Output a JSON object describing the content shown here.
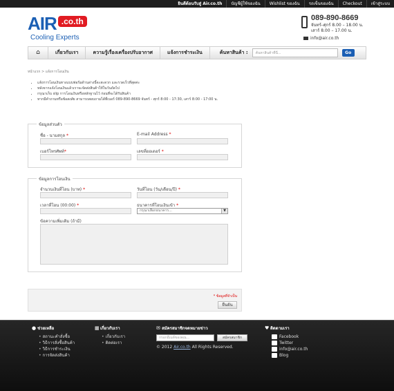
{
  "topbar": {
    "links": [
      "ยินดีต้อนรับสู่ Air.co.th",
      "บัญชีผู้ใช้ของฉัน",
      "Wishlist ของฉัน",
      "รถเข็นของฉัน",
      "Checkout",
      "เข้าสู่ระบบ"
    ]
  },
  "logo": {
    "word": "AIR",
    "tag": ".co.th",
    "tagline": "Cooling Experts"
  },
  "contact": {
    "phone": "089-890-8669",
    "hours_line1": "จันทร์–ศุกร์ 8.00 – 18.00 น.",
    "hours_line2": "เสาร์ 8.00 – 17.00 น.",
    "email": "info@air.co.th"
  },
  "nav": {
    "items": [
      "เกี่ยวกับเรา",
      "ความรู้เรื่องเครื่องปรับอากาศ",
      "แจ้งการชำระเงิน"
    ],
    "search_label": "ค้นหาสินค้า :",
    "search_placeholder": "ค้นหาสินค้าที่นี่...",
    "go_label": "Go"
  },
  "breadcrumb": "หน้าแรก  >  แจ้งการโอนเงิน",
  "bullets": [
    "แจ้งการโอนเงินทางแบบฟอร์มด้านล่างนี้จะสะดวก และรวดเร็วที่สุดค่ะ",
    "หลังจากแจ้งโอนเงินแล้วเราจะจัดส่งสินค้าให้ในวันถัดไป",
    "กรุณาเก็บ slip การโอนเงินหรือหลักฐานไว้ ก่อนที่จะได้รับสินค้า",
    "หากมีคำถามหรือข้อสงสัย สามารถสอบถามได้ที่เบอร์ 089-890-8669 จันทร์ - ศุกร์ 8:00 - 17:30, เสาร์ 8:00 - 17:00 น."
  ],
  "personal": {
    "legend": "ข้อมูลส่วนตัว",
    "name_label": "ชื่อ - นามสกุล",
    "email_label": "E-mail Address",
    "phone_label": "เบอร์โทรศัพท์",
    "order_label": "เลขที่ออเดอร์",
    "required_mark": "*"
  },
  "transfer": {
    "legend": "ข้อมูลการโอนเงิน",
    "amount_label": "จำนวนเงินที่โอน (บาท)",
    "date_label": "วันที่โอน (วัน/เดือน/ปี)",
    "time_label": "เวลาที่โอน (00:00)",
    "bank_label": "ธนาคารที่โอนเงินเข้า",
    "bank_selected": "กรุณาเลือกธนาคาร...",
    "notes_label": "ข้อความเพิ่มเติม (ถ้ามี)",
    "required_mark": "*"
  },
  "submit": {
    "required_note": "* ข้อมูลที่จำเป็น",
    "button_label": "ยืนยัน"
  },
  "footer": {
    "help_title": "ช่วยเหลือ",
    "help_items": [
      "สถานะคำสั่งซื้อ",
      "วิธีการสั่งซื้อสินค้า",
      "วิธีการชำระเงิน",
      "การจัดส่งสินค้า"
    ],
    "about_title": "เกี่ยวกับเรา",
    "about_items": [
      "เกี่ยวกับเรา",
      "ติดต่อเรา"
    ],
    "newsletter_title": "สมัครสมาชิกจดหมายข่าว",
    "newsletter_placeholder": "กรอกอีเมล์ของคุณ...",
    "newsletter_button": "สมัครสมาชิก",
    "copyright_prefix": "© 2012",
    "copyright_link": "Air.co.th",
    "copyright_suffix": "All Rights Reserved.",
    "follow_title": "ติดตามเรา",
    "social": [
      "Facebook",
      "Twitter",
      "info@air.co.th",
      "Blog"
    ]
  }
}
